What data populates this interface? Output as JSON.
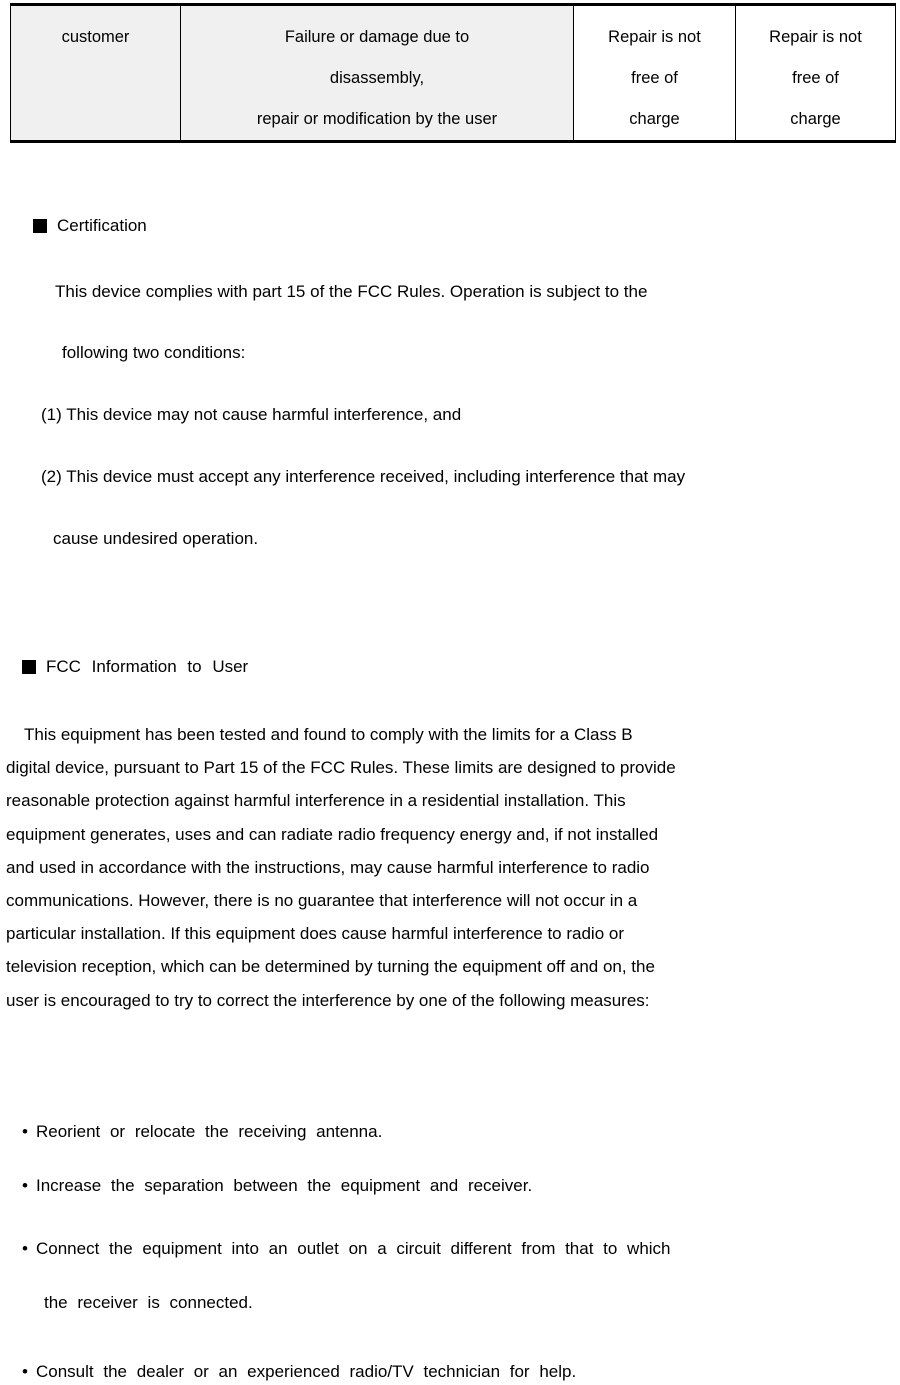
{
  "warranty_table": {
    "colors": {
      "shaded_cell_bg": "#f0f0f0",
      "plain_cell_bg": "#ffffff",
      "border": "#000000"
    },
    "rows": [
      {
        "responsible_party": "customer",
        "cause_lines": [
          "Failure or damage due to",
          "disassembly,",
          "repair or modification by the user"
        ],
        "within_warranty_lines": [
          "Repair is not",
          "free of",
          "charge"
        ],
        "outside_warranty_lines": [
          "Repair is not",
          "free of",
          "charge"
        ]
      }
    ]
  },
  "certification": {
    "marker": "black-square-marker",
    "heading": "Certification",
    "lines": [
      "This device complies with part 15 of the FCC Rules. Operation is subject to the",
      "following two conditions:",
      "(1) This device may not cause harmful interference, and",
      "(2) This device must accept any interference received, including interference that may",
      "cause undesired operation."
    ]
  },
  "fcc_information": {
    "marker": "black-square-marker",
    "heading": "FCC  Information  to  User",
    "paragraph_lines": [
      "This equipment has been tested and found to comply with the limits for a Class B",
      "digital device, pursuant to Part 15 of the FCC Rules. These limits are designed to provide",
      "reasonable protection against harmful interference in a residential installation. This",
      "equipment generates, uses and can radiate radio frequency energy and, if not installed",
      "and used in accordance with the instructions, may cause harmful interference to radio",
      "communications. However, there is no guarantee that interference will not occur in a",
      "particular installation. If this equipment does cause harmful interference to radio or",
      "television reception, which can be determined by turning the equipment off and on, the",
      "user is encouraged to try to correct the interference by one of the following measures:"
    ],
    "bullet_symbol": "•",
    "measures": [
      {
        "text": "Reorient  or  relocate  the  receiving  antenna."
      },
      {
        "text": "Increase  the  separation  between  the  equipment  and  receiver."
      },
      {
        "text": "Connect  the  equipment  into  an  outlet  on  a  circuit  different  from  that  to  which",
        "continuation": "the  receiver  is  connected."
      },
      {
        "text": "Consult  the  dealer  or  an  experienced  radio/TV  technician  for  help."
      }
    ]
  }
}
